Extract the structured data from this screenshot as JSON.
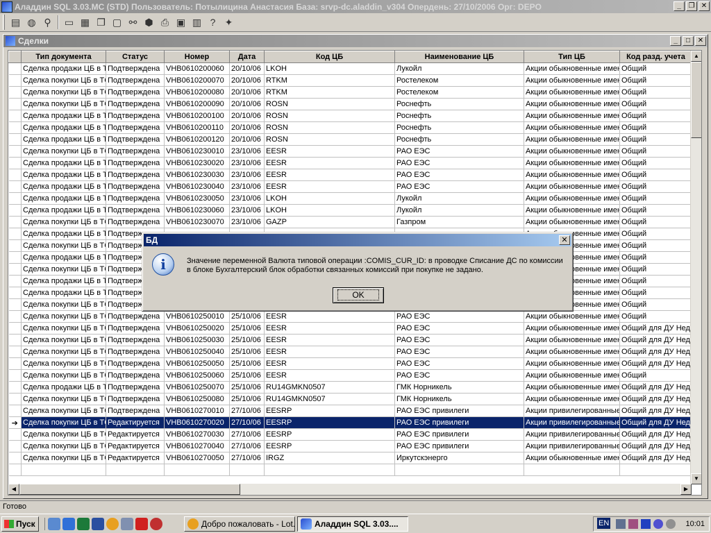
{
  "app": {
    "title": "Аладдин SQL 3.03.MC (STD)  Пользователь: Потылицина Анастасия База: srvp-dc.aladdin_v304 Опердень: 27/10/2006 Орг: DEPO"
  },
  "window": {
    "title": "Сделки"
  },
  "grid": {
    "columns": [
      "Тип документа",
      "Статус",
      "Номер",
      "Дата",
      "Код ЦБ",
      "Наименование ЦБ",
      "Тип ЦБ",
      "Код разд. учета"
    ],
    "rows": [
      [
        "Сделка продажи ЦБ в ТС",
        "Подтверждена",
        "VHB0610200060",
        "20/10/06",
        "LKOH",
        "Лукойл",
        "Акции обыкновенные именные",
        "Общий"
      ],
      [
        "Сделка покупки ЦБ в ТС",
        "Подтверждена",
        "VHB0610200070",
        "20/10/06",
        "RTKM",
        "Ростелеком",
        "Акции обыкновенные именные",
        "Общий"
      ],
      [
        "Сделка покупки ЦБ в ТС",
        "Подтверждена",
        "VHB0610200080",
        "20/10/06",
        "RTKM",
        "Ростелеком",
        "Акции обыкновенные именные",
        "Общий"
      ],
      [
        "Сделка покупки ЦБ в ТС",
        "Подтверждена",
        "VHB0610200090",
        "20/10/06",
        "ROSN",
        "Роснефть",
        "Акции обыкновенные именные",
        "Общий"
      ],
      [
        "Сделка продажи ЦБ в ТС",
        "Подтверждена",
        "VHB0610200100",
        "20/10/06",
        "ROSN",
        "Роснефть",
        "Акции обыкновенные именные",
        "Общий"
      ],
      [
        "Сделка продажи ЦБ в ТС",
        "Подтверждена",
        "VHB0610200110",
        "20/10/06",
        "ROSN",
        "Роснефть",
        "Акции обыкновенные именные",
        "Общий"
      ],
      [
        "Сделка продажи ЦБ в ТС",
        "Подтверждена",
        "VHB0610200120",
        "20/10/06",
        "ROSN",
        "Роснефть",
        "Акции обыкновенные именные",
        "Общий"
      ],
      [
        "Сделка покупки ЦБ в ТС",
        "Подтверждена",
        "VHB0610230010",
        "23/10/06",
        "EESR",
        "РАО ЕЭС",
        "Акции обыкновенные именные",
        "Общий"
      ],
      [
        "Сделка продажи ЦБ в ТС",
        "Подтверждена",
        "VHB0610230020",
        "23/10/06",
        "EESR",
        "РАО ЕЭС",
        "Акции обыкновенные именные",
        "Общий"
      ],
      [
        "Сделка продажи ЦБ в ТС",
        "Подтверждена",
        "VHB0610230030",
        "23/10/06",
        "EESR",
        "РАО ЕЭС",
        "Акции обыкновенные именные",
        "Общий"
      ],
      [
        "Сделка продажи ЦБ в ТС",
        "Подтверждена",
        "VHB0610230040",
        "23/10/06",
        "EESR",
        "РАО ЕЭС",
        "Акции обыкновенные именные",
        "Общий"
      ],
      [
        "Сделка продажи ЦБ в ТС",
        "Подтверждена",
        "VHB0610230050",
        "23/10/06",
        "LKOH",
        "Лукойл",
        "Акции обыкновенные именные",
        "Общий"
      ],
      [
        "Сделка продажи ЦБ в ТС",
        "Подтверждена",
        "VHB0610230060",
        "23/10/06",
        "LKOH",
        "Лукойл",
        "Акции обыкновенные именные",
        "Общий"
      ],
      [
        "Сделка покупки ЦБ в ТС",
        "Подтверждена",
        "VHB0610230070",
        "23/10/06",
        "GAZP",
        "Газпром",
        "Акции обыкновенные именные",
        "Общий"
      ],
      [
        "Сделка продажи ЦБ в ТС",
        "Подтверждена",
        "",
        "",
        "",
        "",
        "Акции обыкновенные именные",
        "Общий"
      ],
      [
        "Сделка покупки ЦБ в ТС",
        "Подтверждена",
        "",
        "",
        "",
        "",
        "Акции обыкновенные именные",
        "Общий"
      ],
      [
        "Сделка продажи ЦБ в ТС",
        "Подтверждена",
        "",
        "",
        "",
        "",
        "Акции обыкновенные именные",
        "Общий"
      ],
      [
        "Сделка покупки ЦБ в ТС",
        "Подтверждена",
        "",
        "",
        "",
        "",
        "Акции обыкновенные именные",
        "Общий"
      ],
      [
        "Сделка продажи ЦБ в ТС",
        "Подтверждена",
        "",
        "",
        "",
        "",
        "Акции обыкновенные именные",
        "Общий"
      ],
      [
        "Сделка продажи ЦБ в ТС",
        "Подтверждена",
        "",
        "",
        "",
        "",
        "Акции обыкновенные именные",
        "Общий"
      ],
      [
        "Сделка покупки ЦБ в ТС",
        "Подтверждена",
        "",
        "",
        "",
        "",
        "Акции обыкновенные именные",
        "Общий"
      ],
      [
        "Сделка покупки ЦБ в ТС",
        "Подтверждена",
        "VHB0610250010",
        "25/10/06",
        "EESR",
        "РАО ЕЭС",
        "Акции обыкновенные именные",
        "Общий"
      ],
      [
        "Сделка покупки ЦБ в ТС",
        "Подтверждена",
        "VHB0610250020",
        "25/10/06",
        "EESR",
        "РАО ЕЭС",
        "Акции обыкновенные именные",
        "Общий для ДУ Недвиж"
      ],
      [
        "Сделка покупки ЦБ в ТС",
        "Подтверждена",
        "VHB0610250030",
        "25/10/06",
        "EESR",
        "РАО ЕЭС",
        "Акции обыкновенные именные",
        "Общий для ДУ Недвиж"
      ],
      [
        "Сделка покупки ЦБ в ТС",
        "Подтверждена",
        "VHB0610250040",
        "25/10/06",
        "EESR",
        "РАО ЕЭС",
        "Акции обыкновенные именные",
        "Общий для ДУ Недвиж"
      ],
      [
        "Сделка покупки ЦБ в ТС",
        "Подтверждена",
        "VHB0610250050",
        "25/10/06",
        "EESR",
        "РАО ЕЭС",
        "Акции обыкновенные именные",
        "Общий для ДУ Недвиж"
      ],
      [
        "Сделка покупки ЦБ в ТС",
        "Подтверждена",
        "VHB0610250060",
        "25/10/06",
        "EESR",
        "РАО ЕЭС",
        "Акции обыкновенные именные",
        "Общий"
      ],
      [
        "Сделка продажи ЦБ в ТС",
        "Подтверждена",
        "VHB0610250070",
        "25/10/06",
        "RU14GMKN0507",
        "ГМК Норникель",
        "Акции обыкновенные именные",
        "Общий для ДУ Недвиж"
      ],
      [
        "Сделка покупки ЦБ в ТС",
        "Подтверждена",
        "VHB0610250080",
        "25/10/06",
        "RU14GMKN0507",
        "ГМК Норникель",
        "Акции обыкновенные именные",
        "Общий для ДУ Недвиж"
      ],
      [
        "Сделка покупки ЦБ в ТС",
        "Подтверждена",
        "VHB0610270010",
        "27/10/06",
        "EESRP",
        "РАО ЕЭС привилеги",
        "Акции привилегированные",
        "Общий для ДУ Недвиж"
      ],
      [
        "Сделка покупки ЦБ в ТС",
        "Редактируется",
        "VHB0610270020",
        "27/10/06",
        "EESRP",
        "РАО ЕЭС привилеги",
        "Акции привилегированные",
        "Общий для ДУ Недвиж"
      ],
      [
        "Сделка покупки ЦБ в ТС",
        "Редактируется",
        "VHB0610270030",
        "27/10/06",
        "EESRP",
        "РАО ЕЭС привилеги",
        "Акции привилегированные",
        "Общий для ДУ Недвиж"
      ],
      [
        "Сделка покупки ЦБ в ТС",
        "Редактируется",
        "VHB0610270040",
        "27/10/06",
        "EESRP",
        "РАО ЕЭС привилеги",
        "Акции привилегированные",
        "Общий для ДУ Недвиж"
      ],
      [
        "Сделка покупки ЦБ в ТС",
        "Редактируется",
        "VHB0610270050",
        "27/10/06",
        "IRGZ",
        "Иркутскэнерго",
        "Акции обыкновенные именные",
        "Общий для ДУ Недвиж"
      ]
    ],
    "selected_row": 30,
    "selection_color": "#0a246a"
  },
  "dialog": {
    "title": "БД",
    "icon": "info-icon",
    "message": "Значение переменной Валюта типовой операции :COMIS_CUR_ID: в проводке Списание ДС по комиссии в блоке Бухгалтерский блок обработки связанных комиссий при покупке не задано.",
    "ok_label": "OK"
  },
  "status": {
    "text": "Готово"
  },
  "taskbar": {
    "start_label": "Пуск",
    "tasks": [
      {
        "label": "Добро пожаловать - Lot...",
        "active": false
      },
      {
        "label": "Аладдин SQL 3.03....",
        "active": true
      }
    ],
    "lang": "EN",
    "clock": "10:01"
  }
}
